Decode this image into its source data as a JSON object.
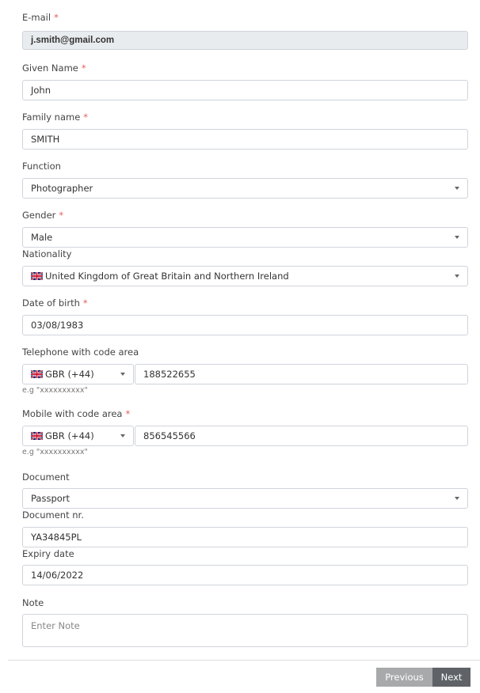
{
  "form": {
    "required_mark": "*",
    "email": {
      "label": "E-mail",
      "value": "j.smith@gmail.com"
    },
    "given_name": {
      "label": "Given Name",
      "value": "John"
    },
    "family_name": {
      "label": "Family name",
      "value": "SMITH"
    },
    "function": {
      "label": "Function",
      "value": "Photographer"
    },
    "gender": {
      "label": "Gender",
      "value": "Male"
    },
    "nationality": {
      "label": "Nationality",
      "value": "United Kingdom of Great Britain and Northern Ireland",
      "flag": "uk-flag-icon"
    },
    "date_of_birth": {
      "label": "Date of birth",
      "value": "03/08/1983"
    },
    "telephone": {
      "label": "Telephone with code area",
      "code": "GBR (+44)",
      "value": "188522655",
      "hint": "e.g \"xxxxxxxxxx\"",
      "flag": "uk-flag-icon"
    },
    "mobile": {
      "label": "Mobile with code area",
      "code": "GBR (+44)",
      "value": "856545566",
      "hint": "e.g \"xxxxxxxxxx\"",
      "flag": "uk-flag-icon"
    },
    "document": {
      "label": "Document",
      "value": "Passport"
    },
    "document_nr": {
      "label": "Document nr.",
      "value": "YA34845PL"
    },
    "expiry_date": {
      "label": "Expiry date",
      "value": "14/06/2022"
    },
    "note": {
      "label": "Note",
      "placeholder": "Enter Note"
    }
  },
  "buttons": {
    "previous": "Previous",
    "next": "Next"
  }
}
